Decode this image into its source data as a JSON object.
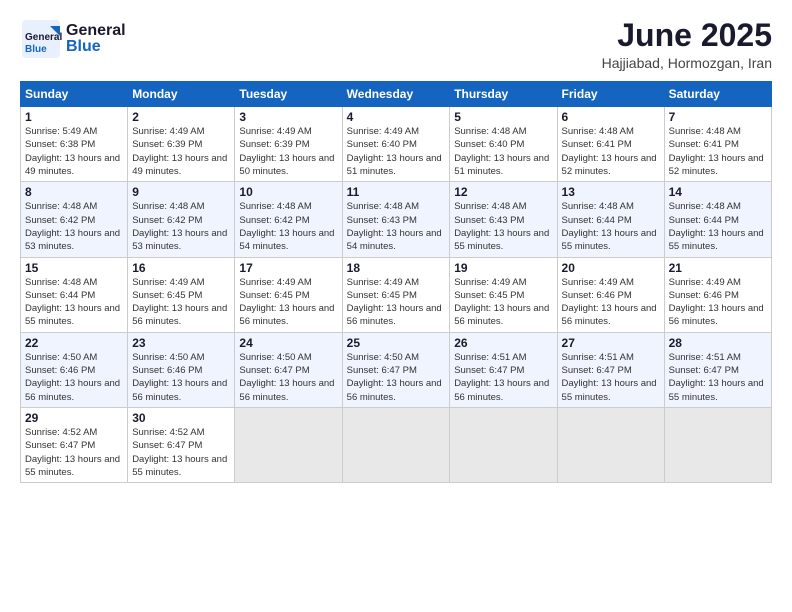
{
  "header": {
    "logo_general": "General",
    "logo_blue": "Blue",
    "month_title": "June 2025",
    "location": "Hajjiabad, Hormozgan, Iran"
  },
  "weekdays": [
    "Sunday",
    "Monday",
    "Tuesday",
    "Wednesday",
    "Thursday",
    "Friday",
    "Saturday"
  ],
  "weeks": [
    [
      {
        "day": "1",
        "sunrise": "5:49 AM",
        "sunset": "6:38 PM",
        "daylight": "13 hours and 49 minutes."
      },
      {
        "day": "2",
        "sunrise": "4:49 AM",
        "sunset": "6:39 PM",
        "daylight": "13 hours and 49 minutes."
      },
      {
        "day": "3",
        "sunrise": "4:49 AM",
        "sunset": "6:39 PM",
        "daylight": "13 hours and 50 minutes."
      },
      {
        "day": "4",
        "sunrise": "4:49 AM",
        "sunset": "6:40 PM",
        "daylight": "13 hours and 51 minutes."
      },
      {
        "day": "5",
        "sunrise": "4:48 AM",
        "sunset": "6:40 PM",
        "daylight": "13 hours and 51 minutes."
      },
      {
        "day": "6",
        "sunrise": "4:48 AM",
        "sunset": "6:41 PM",
        "daylight": "13 hours and 52 minutes."
      },
      {
        "day": "7",
        "sunrise": "4:48 AM",
        "sunset": "6:41 PM",
        "daylight": "13 hours and 52 minutes."
      }
    ],
    [
      {
        "day": "8",
        "sunrise": "4:48 AM",
        "sunset": "6:42 PM",
        "daylight": "13 hours and 53 minutes."
      },
      {
        "day": "9",
        "sunrise": "4:48 AM",
        "sunset": "6:42 PM",
        "daylight": "13 hours and 53 minutes."
      },
      {
        "day": "10",
        "sunrise": "4:48 AM",
        "sunset": "6:42 PM",
        "daylight": "13 hours and 54 minutes."
      },
      {
        "day": "11",
        "sunrise": "4:48 AM",
        "sunset": "6:43 PM",
        "daylight": "13 hours and 54 minutes."
      },
      {
        "day": "12",
        "sunrise": "4:48 AM",
        "sunset": "6:43 PM",
        "daylight": "13 hours and 55 minutes."
      },
      {
        "day": "13",
        "sunrise": "4:48 AM",
        "sunset": "6:44 PM",
        "daylight": "13 hours and 55 minutes."
      },
      {
        "day": "14",
        "sunrise": "4:48 AM",
        "sunset": "6:44 PM",
        "daylight": "13 hours and 55 minutes."
      }
    ],
    [
      {
        "day": "15",
        "sunrise": "4:48 AM",
        "sunset": "6:44 PM",
        "daylight": "13 hours and 55 minutes."
      },
      {
        "day": "16",
        "sunrise": "4:49 AM",
        "sunset": "6:45 PM",
        "daylight": "13 hours and 56 minutes."
      },
      {
        "day": "17",
        "sunrise": "4:49 AM",
        "sunset": "6:45 PM",
        "daylight": "13 hours and 56 minutes."
      },
      {
        "day": "18",
        "sunrise": "4:49 AM",
        "sunset": "6:45 PM",
        "daylight": "13 hours and 56 minutes."
      },
      {
        "day": "19",
        "sunrise": "4:49 AM",
        "sunset": "6:45 PM",
        "daylight": "13 hours and 56 minutes."
      },
      {
        "day": "20",
        "sunrise": "4:49 AM",
        "sunset": "6:46 PM",
        "daylight": "13 hours and 56 minutes."
      },
      {
        "day": "21",
        "sunrise": "4:49 AM",
        "sunset": "6:46 PM",
        "daylight": "13 hours and 56 minutes."
      }
    ],
    [
      {
        "day": "22",
        "sunrise": "4:50 AM",
        "sunset": "6:46 PM",
        "daylight": "13 hours and 56 minutes."
      },
      {
        "day": "23",
        "sunrise": "4:50 AM",
        "sunset": "6:46 PM",
        "daylight": "13 hours and 56 minutes."
      },
      {
        "day": "24",
        "sunrise": "4:50 AM",
        "sunset": "6:47 PM",
        "daylight": "13 hours and 56 minutes."
      },
      {
        "day": "25",
        "sunrise": "4:50 AM",
        "sunset": "6:47 PM",
        "daylight": "13 hours and 56 minutes."
      },
      {
        "day": "26",
        "sunrise": "4:51 AM",
        "sunset": "6:47 PM",
        "daylight": "13 hours and 56 minutes."
      },
      {
        "day": "27",
        "sunrise": "4:51 AM",
        "sunset": "6:47 PM",
        "daylight": "13 hours and 55 minutes."
      },
      {
        "day": "28",
        "sunrise": "4:51 AM",
        "sunset": "6:47 PM",
        "daylight": "13 hours and 55 minutes."
      }
    ],
    [
      {
        "day": "29",
        "sunrise": "4:52 AM",
        "sunset": "6:47 PM",
        "daylight": "13 hours and 55 minutes."
      },
      {
        "day": "30",
        "sunrise": "4:52 AM",
        "sunset": "6:47 PM",
        "daylight": "13 hours and 55 minutes."
      },
      null,
      null,
      null,
      null,
      null
    ]
  ]
}
